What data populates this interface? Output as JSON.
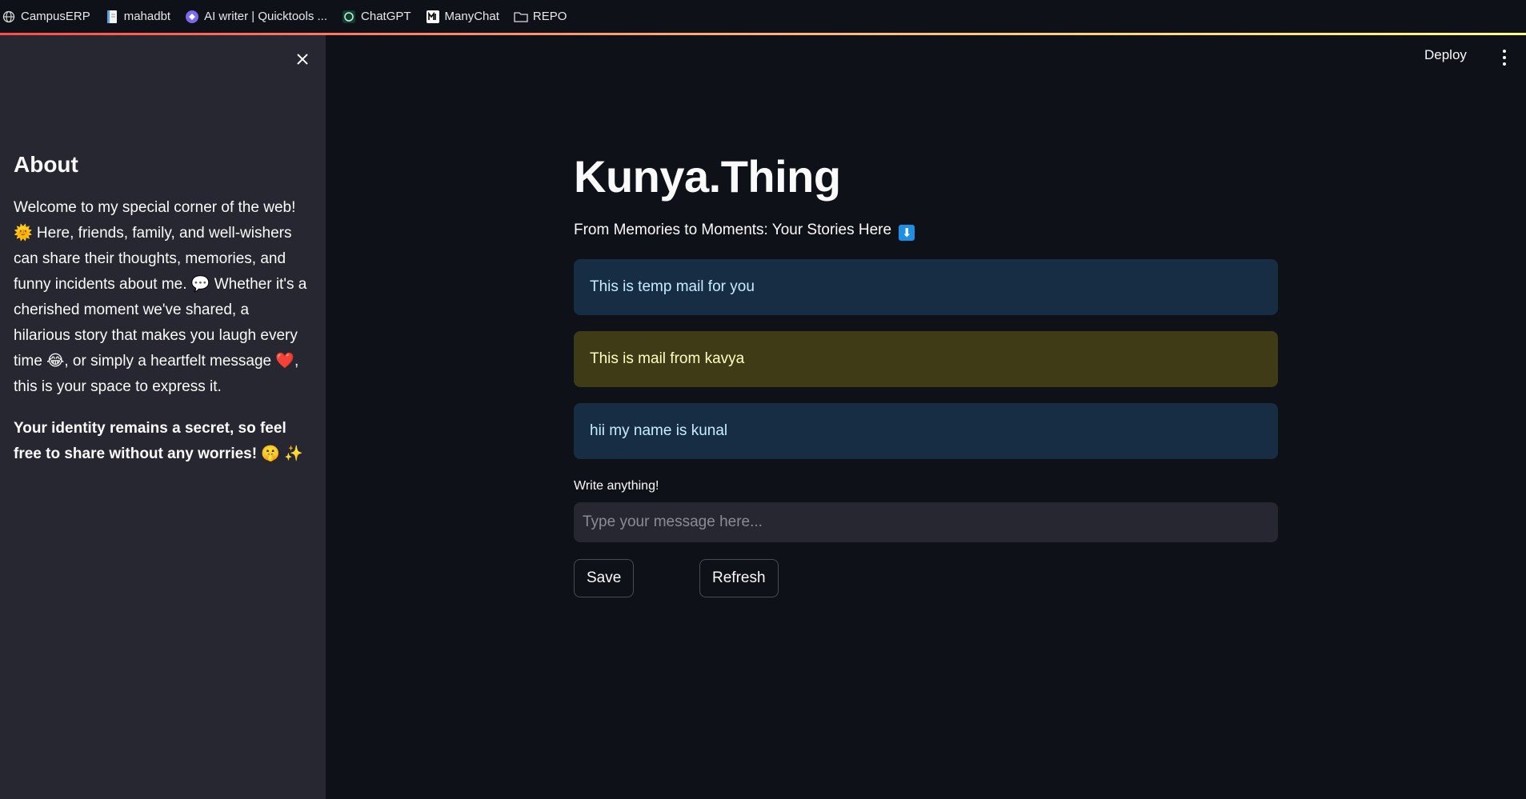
{
  "bookmarks": [
    {
      "label": "CampusERP",
      "icon": "globe-icon"
    },
    {
      "label": "mahadbt",
      "icon": "document-icon"
    },
    {
      "label": "AI writer | Quicktools ...",
      "icon": "quicktools-icon"
    },
    {
      "label": "ChatGPT",
      "icon": "chatgpt-icon"
    },
    {
      "label": "ManyChat",
      "icon": "manychat-icon"
    },
    {
      "label": "REPO",
      "icon": "folder-icon"
    }
  ],
  "header": {
    "deploy_label": "Deploy"
  },
  "sidebar": {
    "heading": "About",
    "text": "Welcome to my special corner of the web! 🌞 Here, friends, family, and well-wishers can share their thoughts, memories, and funny incidents about me. 💬 Whether it's a cherished moment we've shared, a hilarious story that makes you laugh every time 😂, or simply a heartfelt message ❤️, this is your space to express it.",
    "bold_text": "Your identity remains a secret, so feel free to share without any worries! 🤫 ✨"
  },
  "main": {
    "title": "Kunya.Thing",
    "subtitle": "From Memories to Moments: Your Stories Here",
    "subtitle_emoji": "⬇",
    "messages": [
      {
        "text": "This is temp mail for you",
        "style": "blue"
      },
      {
        "text": "This is mail from kavya",
        "style": "yellow"
      },
      {
        "text": "hii my name is kunal",
        "style": "blue"
      }
    ],
    "input_label": "Write anything!",
    "input_placeholder": "Type your message here...",
    "input_value": "",
    "save_label": "Save",
    "refresh_label": "Refresh"
  },
  "colors": {
    "background": "#0e1117",
    "sidebar": "#262730",
    "info_bg": "#172d43",
    "warning_bg": "#3e3b16"
  }
}
